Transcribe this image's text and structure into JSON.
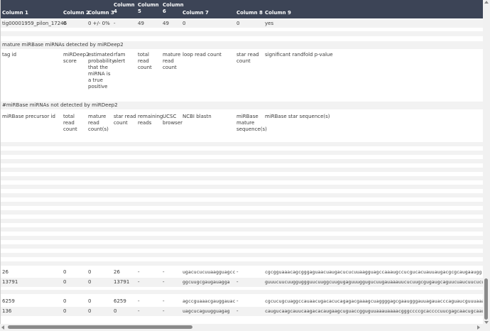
{
  "header_columns": [
    "Column 1",
    "Column 2",
    "Column 3",
    "Column 4",
    "Column 5",
    "Column 6",
    "Column 7",
    "Column 8",
    "Column 9"
  ],
  "summary_row": [
    "tig00001959_pilon_17246",
    "0",
    "0 +/- 0%",
    "-",
    "49",
    "49",
    "0",
    "0",
    "yes"
  ],
  "section_detected": {
    "title": "mature miRBase miRNAs detected by miRDeep2",
    "headers": [
      "tag id",
      "miRDeep2 score",
      "estimated probability that the miRNA is a true positive",
      "rfam alert",
      "total read count",
      "mature read count",
      "loop read count",
      "star read count",
      "significant randfold p-value"
    ]
  },
  "section_not_detected": {
    "title": "#miRBase miRNAs not detected by miRDeep2",
    "headers": [
      "miRBase precursor id",
      "total read count",
      "mature read count(s)",
      "star read count",
      "remaining reads",
      "UCSC browser",
      "NCBI blastn",
      "miRBase mature sequence(s)",
      "miRBase star sequence(s)"
    ]
  },
  "data_rows": [
    [
      "26",
      "0",
      "0",
      "26",
      "-",
      "-",
      "ugacucucuuaagguagcca",
      "-",
      "cgcgguaaacagcgggaguaacuaugacucucuuaagguagccaaaugccucgucacuauuaugacgcgcaugaaugg"
    ],
    [
      "13791",
      "0",
      "0",
      "13791",
      "-",
      "-",
      "ggcuugcgaugauagga",
      "-",
      "guuucuucuugguggguucuuggcuugugaguuuggugucuugauaaauucucuugcgugaugcaguucuaucuucucugg"
    ],
    [
      "6259",
      "0",
      "0",
      "6259",
      "-",
      "-",
      "agccguaaacgauggauacu",
      "-",
      "cgcucugcuaggccauaacugacacucagagacgaaagcuaggggagcgaaugggauuagauacccaguaucguuuaaacg"
    ],
    [
      "136",
      "0",
      "0",
      "0",
      "-",
      "-",
      "uagcucaguugguagag",
      "-",
      "caugucaagcauucaagacacaugaagcuguaccgguguuaaauaaaacgggccccgcaccccuucgagcaacugcaaugccg"
    ]
  ]
}
